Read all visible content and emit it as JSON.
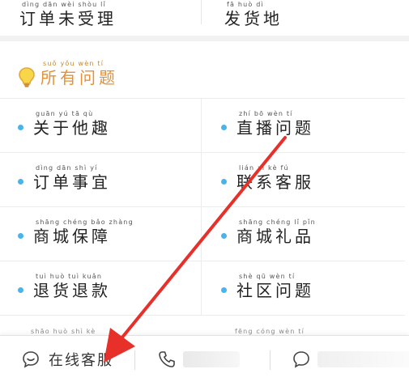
{
  "top_row": {
    "left": {
      "pinyin": "dìng dān wèi shòu lǐ",
      "text": "订单未受理"
    },
    "right": {
      "pinyin": "fā huò dì",
      "text": "发货地"
    }
  },
  "section": {
    "icon": "lightbulb-icon",
    "pinyin": "suǒ yǒu wèn tí",
    "title": "所有问题"
  },
  "questions": [
    {
      "left": {
        "pinyin": "guān yú tā qù",
        "text": "关于他趣"
      },
      "right": {
        "pinyin": "zhí bō wèn tí",
        "text": "直播问题"
      }
    },
    {
      "left": {
        "pinyin": "dìng dān shì yí",
        "text": "订单事宜"
      },
      "right": {
        "pinyin": "lián xì kè fú",
        "text": "联系客服"
      }
    },
    {
      "left": {
        "pinyin": "shāng chéng bǎo zhàng",
        "text": "商城保障"
      },
      "right": {
        "pinyin": "shāng chéng lǐ pǐn",
        "text": "商城礼品"
      }
    },
    {
      "left": {
        "pinyin": "tuì huò tuì kuǎn",
        "text": "退货退款"
      },
      "right": {
        "pinyin": "shè qū wèn tí",
        "text": "社区问题"
      }
    }
  ],
  "partial_row": {
    "left": "shāo huò shì kè",
    "right": "fēng cóng wèn tí"
  },
  "bottom_bar": {
    "online_service": {
      "icon": "chat-bubble-icon",
      "label": "在线客服"
    },
    "phone": {
      "icon": "phone-icon"
    },
    "message": {
      "icon": "message-icon"
    }
  },
  "colors": {
    "accent_orange": "#e2913a",
    "dot_blue": "#4ab3ea",
    "arrow_red": "#e8302a"
  }
}
